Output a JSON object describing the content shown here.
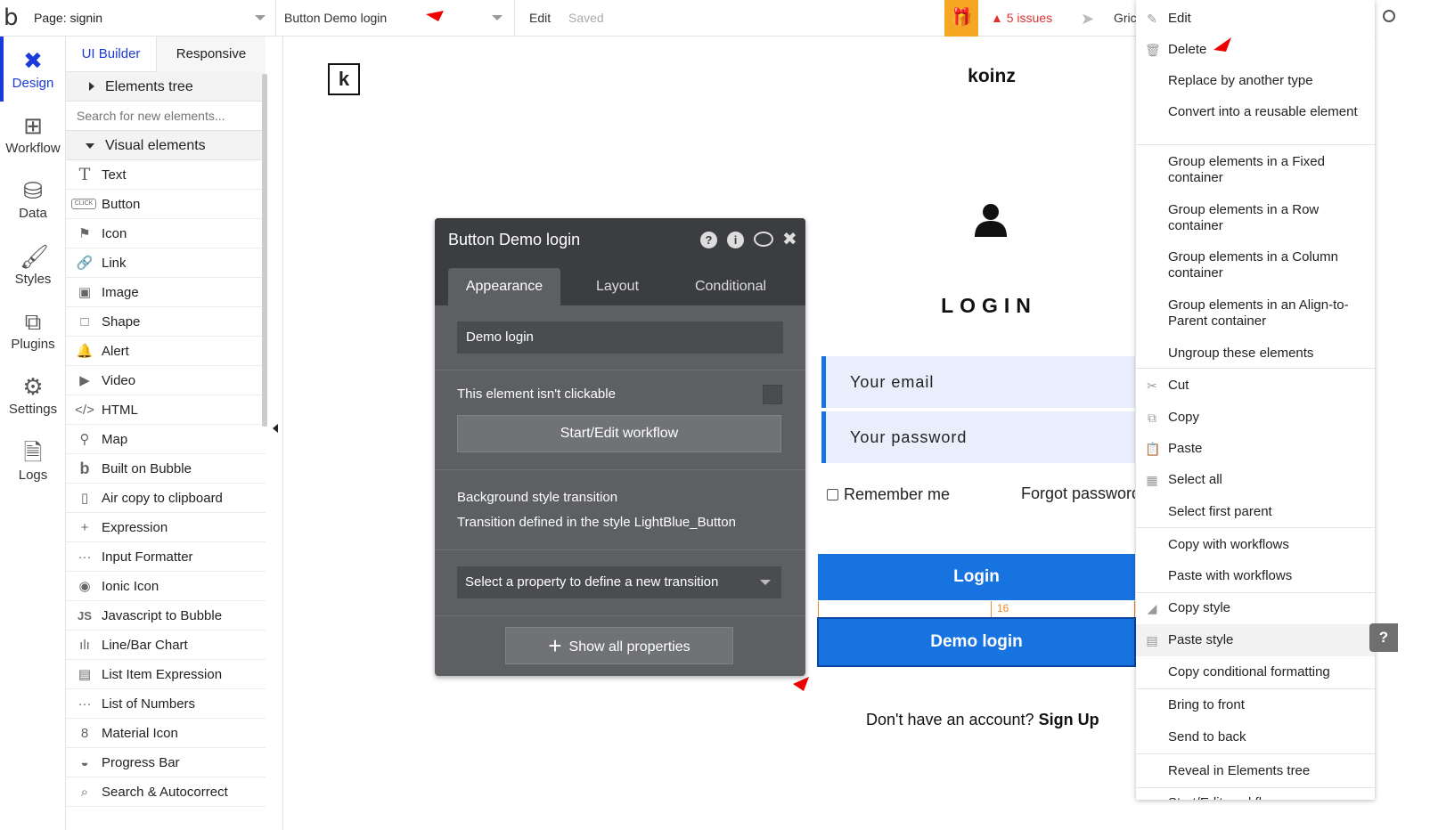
{
  "topbar": {
    "page_label": "Page: signin",
    "element_label": "Button Demo login",
    "edit_label": "Edit",
    "saved_label": "Saved",
    "issues_label": "5 issues",
    "grid_label": "Gric"
  },
  "leftnav": {
    "items": [
      {
        "label": "Design",
        "icon": "design-icon"
      },
      {
        "label": "Workflow",
        "icon": "workflow-icon"
      },
      {
        "label": "Data",
        "icon": "database-icon"
      },
      {
        "label": "Styles",
        "icon": "brush-icon"
      },
      {
        "label": "Plugins",
        "icon": "plugin-icon"
      },
      {
        "label": "Settings",
        "icon": "gear-icon"
      },
      {
        "label": "Logs",
        "icon": "document-icon"
      }
    ]
  },
  "panel": {
    "tab_builder": "UI Builder",
    "tab_responsive": "Responsive",
    "elements_tree": "Elements tree",
    "search_placeholder": "Search for new elements...",
    "visual_elements": "Visual elements",
    "elements": [
      {
        "label": "Text",
        "icon": "T"
      },
      {
        "label": "Button",
        "icon": "CLICK"
      },
      {
        "label": "Icon",
        "icon": "⚑"
      },
      {
        "label": "Link",
        "icon": "🔗"
      },
      {
        "label": "Image",
        "icon": "▣"
      },
      {
        "label": "Shape",
        "icon": "□"
      },
      {
        "label": "Alert",
        "icon": "🔔"
      },
      {
        "label": "Video",
        "icon": "▶"
      },
      {
        "label": "HTML",
        "icon": "</>"
      },
      {
        "label": "Map",
        "icon": "⚲"
      },
      {
        "label": "Built on Bubble",
        "icon": "b"
      },
      {
        "label": "Air copy to clipboard",
        "icon": "▯"
      },
      {
        "label": "Expression",
        "icon": "+"
      },
      {
        "label": "Input Formatter",
        "icon": "···"
      },
      {
        "label": "Ionic Icon",
        "icon": "◉"
      },
      {
        "label": "Javascript to Bubble",
        "icon": "JS"
      },
      {
        "label": "Line/Bar Chart",
        "icon": "ılı"
      },
      {
        "label": "List Item Expression",
        "icon": "▤"
      },
      {
        "label": "List of Numbers",
        "icon": "···"
      },
      {
        "label": "Material Icon",
        "icon": "8"
      },
      {
        "label": "Progress Bar",
        "icon": "◒"
      },
      {
        "label": "Search & Autocorrect",
        "icon": "⌕"
      }
    ]
  },
  "canvas": {
    "logo_letter": "k",
    "brand": "koinz",
    "login_title": "LOGIN",
    "email_placeholder": "Your email",
    "password_placeholder": "Your password",
    "remember_me": "Remember me",
    "forgot_password": "Forgot password",
    "login_button": "Login",
    "gap_value": "16",
    "demo_login_button": "Demo login",
    "no_account": "Don't have an account?",
    "sign_up": "Sign Up"
  },
  "inspector": {
    "title": "Button Demo login",
    "tabs": [
      "Appearance",
      "Layout",
      "Conditional"
    ],
    "text_value": "Demo login",
    "not_clickable": "This element isn't clickable",
    "workflow_button": "Start/Edit workflow",
    "bg_transition_title": "Background style transition",
    "bg_transition_desc": "Transition defined in the style LightBlue_Button",
    "select_property": "Select a property to define a new transition",
    "show_all": "Show all properties"
  },
  "context_menu": {
    "items": [
      {
        "label": "Edit",
        "icon": "✎"
      },
      {
        "label": "Delete",
        "icon": "🗑"
      },
      {
        "label": "Replace by another type",
        "icon": ""
      },
      {
        "label": "Convert into a reusable element",
        "icon": ""
      },
      {
        "label": "Group elements in a Fixed container",
        "icon": ""
      },
      {
        "label": "Group elements in a Row container",
        "icon": ""
      },
      {
        "label": "Group elements in a Column container",
        "icon": ""
      },
      {
        "label": "Group elements in an Align-to-Parent container",
        "icon": ""
      },
      {
        "label": "Ungroup these elements",
        "icon": ""
      },
      {
        "label": "Cut",
        "icon": "✂"
      },
      {
        "label": "Copy",
        "icon": "⧉"
      },
      {
        "label": "Paste",
        "icon": "📋"
      },
      {
        "label": "Select all",
        "icon": "▦"
      },
      {
        "label": "Select first parent",
        "icon": ""
      },
      {
        "label": "Copy with workflows",
        "icon": ""
      },
      {
        "label": "Paste with workflows",
        "icon": ""
      },
      {
        "label": "Copy style",
        "icon": "◢"
      },
      {
        "label": "Paste style",
        "icon": "▤"
      },
      {
        "label": "Copy conditional formatting",
        "icon": ""
      },
      {
        "label": "Bring to front",
        "icon": ""
      },
      {
        "label": "Send to back",
        "icon": ""
      },
      {
        "label": "Reveal in Elements tree",
        "icon": ""
      },
      {
        "label": "Start/Edit workflow",
        "icon": ""
      }
    ]
  },
  "help_label": "?",
  "colors": {
    "accent": "#1a3bd9",
    "button_blue": "#1773e0",
    "inspector_bg": "#5d5f62",
    "inspector_header": "#3b3d40",
    "issues_red": "#e03131",
    "gift_orange": "#f5a623"
  }
}
